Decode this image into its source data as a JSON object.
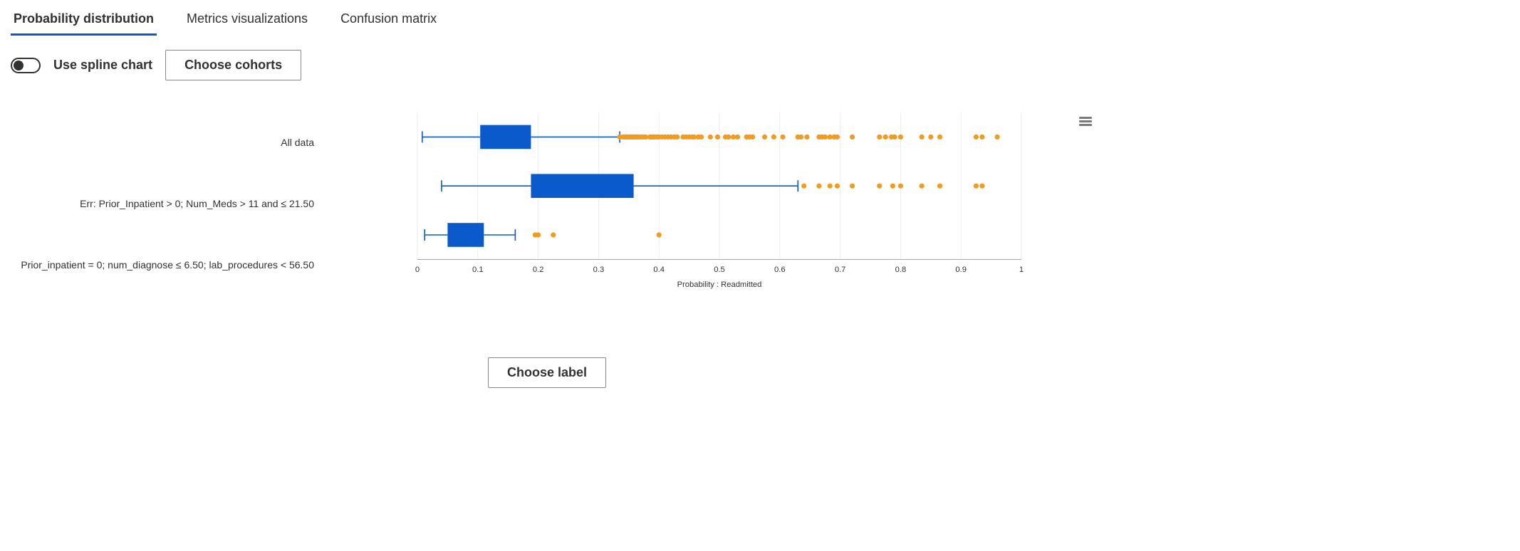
{
  "tabs": [
    {
      "label": "Probability distribution",
      "active": true
    },
    {
      "label": "Metrics visualizations",
      "active": false
    },
    {
      "label": "Confusion matrix",
      "active": false
    }
  ],
  "controls": {
    "spline_toggle_label": "Use spline chart",
    "spline_toggle_on": false,
    "choose_cohorts_label": "Choose cohorts",
    "choose_label_label": "Choose label"
  },
  "colors": {
    "box": "#0b5acb",
    "outlier": "#f39b1c",
    "grid": "#e1e1e1",
    "axis": "#8a8886",
    "tab_underline": "#0b5acb"
  },
  "chart_data": {
    "type": "boxplot",
    "xlabel": "Probability : Readmitted",
    "ylabel": "",
    "xlim": [
      0,
      1
    ],
    "xticks": [
      0,
      0.1,
      0.2,
      0.3,
      0.4,
      0.5,
      0.6,
      0.7,
      0.8,
      0.9,
      1
    ],
    "categories": [
      "All data",
      "Err: Prior_Inpatient > 0; Num_Meds > 11 and ≤ 21.50",
      "Prior_inpatient = 0; num_diagnose ≤ 6.50; lab_procedures < 56.50"
    ],
    "series": [
      {
        "category": "All data",
        "whisker_low": 0.008,
        "q1": 0.104,
        "median": 0.14,
        "q3": 0.188,
        "whisker_high": 0.335,
        "outliers": [
          0.335,
          0.34,
          0.343,
          0.346,
          0.348,
          0.35,
          0.352,
          0.355,
          0.358,
          0.36,
          0.363,
          0.366,
          0.37,
          0.374,
          0.378,
          0.385,
          0.387,
          0.39,
          0.393,
          0.397,
          0.4,
          0.405,
          0.41,
          0.415,
          0.42,
          0.425,
          0.43,
          0.44,
          0.445,
          0.45,
          0.455,
          0.458,
          0.465,
          0.47,
          0.485,
          0.497,
          0.51,
          0.515,
          0.523,
          0.53,
          0.545,
          0.55,
          0.555,
          0.575,
          0.59,
          0.605,
          0.63,
          0.635,
          0.645,
          0.665,
          0.67,
          0.675,
          0.683,
          0.69,
          0.695,
          0.72,
          0.765,
          0.775,
          0.785,
          0.79,
          0.8,
          0.835,
          0.85,
          0.865,
          0.925,
          0.935,
          0.96
        ]
      },
      {
        "category": "Err: Prior_Inpatient > 0; Num_Meds > 11 and ≤ 21.50",
        "whisker_low": 0.04,
        "q1": 0.188,
        "median": 0.27,
        "q3": 0.358,
        "whisker_high": 0.63,
        "outliers": [
          0.64,
          0.665,
          0.683,
          0.695,
          0.72,
          0.765,
          0.787,
          0.8,
          0.835,
          0.865,
          0.925,
          0.935
        ]
      },
      {
        "category": "Prior_inpatient = 0; num_diagnose ≤ 6.50; lab_procedures < 56.50",
        "whisker_low": 0.012,
        "q1": 0.05,
        "median": 0.08,
        "q3": 0.11,
        "whisker_high": 0.162,
        "outliers": [
          0.195,
          0.2,
          0.225,
          0.4
        ]
      }
    ]
  }
}
